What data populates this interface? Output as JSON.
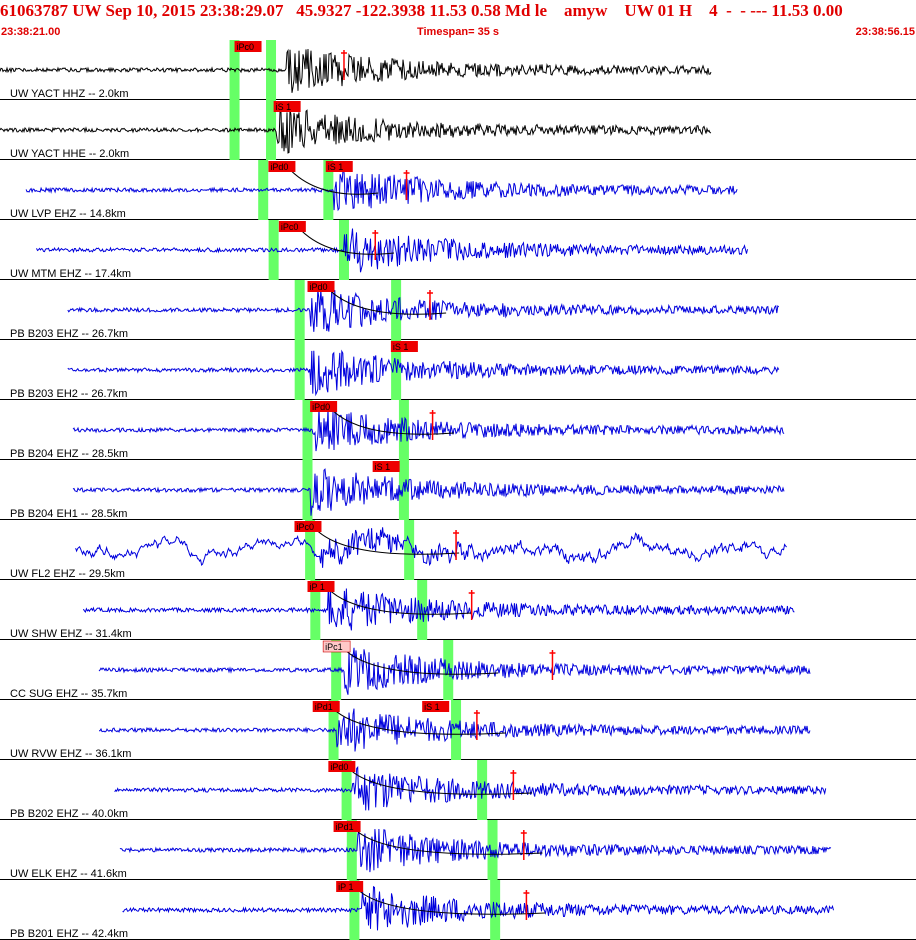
{
  "header": {
    "title": "61063787 UW Sep 10, 2015 23:38:29.07   45.9327 -122.3938 11.53 0.58 Md le    amyw    UW 01 H    4  -  - --- 11.53 0.00",
    "start_time": "23:38:21.00",
    "timespan": "Timespan= 35 s",
    "end_time": "23:38:56.15"
  },
  "colors": {
    "header_text": "#e00000",
    "trace_unfiltered": "#000000",
    "trace": "#0000dd",
    "pick_box": "#ee0000",
    "pick_box_weak": "#ffc8c8",
    "pick_window": "#66ff66",
    "pick_mark": "#ff0000"
  },
  "chart_data": {
    "type": "line",
    "title": "",
    "x_unit": "s",
    "xlim": [
      0,
      35.15
    ],
    "traces": [
      {
        "label": "UW YACT HHZ -- 2.0km",
        "color": "black",
        "start": 0,
        "end": 27.3,
        "amp": 1,
        "p_pick": {
          "label": "iPc0",
          "time": 9.0,
          "weak": false
        },
        "s_pick": null,
        "green": [
          9.0,
          10.4
        ],
        "arrival": 11.0,
        "red_marks": [
          13.2
        ],
        "pcurve": false,
        "wander": false
      },
      {
        "label": "UW YACT HHE -- 2.0km",
        "color": "black",
        "start": 0,
        "end": 27.3,
        "amp": 1,
        "p_pick": null,
        "s_pick": {
          "label": "iS 1",
          "time": 10.5,
          "weak": false
        },
        "green": [
          9.0,
          10.4
        ],
        "arrival": 10.6,
        "red_marks": [],
        "pcurve": false,
        "wander": false
      },
      {
        "label": "UW LVP EHZ -- 14.8km",
        "color": "blue",
        "start": 1.0,
        "end": 28.3,
        "amp": 1,
        "p_pick": {
          "label": "iPd0",
          "time": 10.3,
          "weak": false
        },
        "s_pick": {
          "label": "iS 1",
          "time": 12.5,
          "weak": false
        },
        "green": [
          10.1,
          12.6
        ],
        "arrival": 12.8,
        "red_marks": [
          15.6
        ],
        "pcurve": true,
        "wander": false
      },
      {
        "label": "UW MTM EHZ -- 17.4km",
        "color": "blue",
        "start": 1.4,
        "end": 28.7,
        "amp": 1,
        "p_pick": {
          "label": "iPc0",
          "time": 10.7,
          "weak": false
        },
        "s_pick": null,
        "green": [
          10.5,
          13.2
        ],
        "arrival": 13.2,
        "red_marks": [
          14.4
        ],
        "pcurve": true,
        "wander": false
      },
      {
        "label": "PB B203 EHZ -- 26.7km",
        "color": "blue",
        "start": 2.6,
        "end": 29.9,
        "amp": 1,
        "p_pick": {
          "label": "iPd0",
          "time": 11.8,
          "weak": false
        },
        "s_pick": null,
        "green": [
          11.5,
          15.2
        ],
        "arrival": 11.9,
        "red_marks": [
          16.5
        ],
        "pcurve": true,
        "wander": false
      },
      {
        "label": "PB B203 EH2 -- 26.7km",
        "color": "blue",
        "start": 2.6,
        "end": 29.9,
        "amp": 1,
        "p_pick": null,
        "s_pick": {
          "label": "iS 1",
          "time": 15.0,
          "weak": false
        },
        "green": [
          11.5,
          15.2
        ],
        "arrival": 11.9,
        "red_marks": [],
        "pcurve": false,
        "wander": false
      },
      {
        "label": "PB B204 EHZ -- 28.5km",
        "color": "blue",
        "start": 2.8,
        "end": 30.1,
        "amp": 1,
        "p_pick": {
          "label": "iPd0",
          "time": 11.9,
          "weak": false
        },
        "s_pick": null,
        "green": [
          11.8,
          15.5
        ],
        "arrival": 11.9,
        "red_marks": [
          16.6
        ],
        "pcurve": true,
        "wander": false
      },
      {
        "label": "PB B204 EH1 -- 28.5km",
        "color": "blue",
        "start": 2.8,
        "end": 30.1,
        "amp": 1,
        "p_pick": null,
        "s_pick": {
          "label": "iS 1",
          "time": 14.3,
          "weak": false
        },
        "green": [
          11.8,
          15.5
        ],
        "arrival": 11.9,
        "red_marks": [],
        "pcurve": false,
        "wander": false
      },
      {
        "label": "UW FL2 EHZ -- 29.5km",
        "color": "blue",
        "start": 2.9,
        "end": 30.2,
        "amp": 1,
        "p_pick": {
          "label": "iPc0",
          "time": 11.3,
          "weak": false
        },
        "s_pick": null,
        "green": [
          11.9,
          15.7
        ],
        "arrival": 12.3,
        "red_marks": [
          17.5
        ],
        "pcurve": true,
        "wander": true
      },
      {
        "label": "UW SHW EHZ -- 31.4km",
        "color": "blue",
        "start": 3.2,
        "end": 30.5,
        "amp": 1,
        "p_pick": {
          "label": "iP 1",
          "time": 11.8,
          "weak": false
        },
        "s_pick": null,
        "green": [
          12.1,
          16.2
        ],
        "arrival": 12.6,
        "red_marks": [
          18.1
        ],
        "pcurve": true,
        "wander": false
      },
      {
        "label": "CC SUG EHZ -- 35.7km",
        "color": "blue",
        "start": 3.8,
        "end": 31.1,
        "amp": 1,
        "p_pick": {
          "label": "iPc1",
          "time": 12.4,
          "weak": true
        },
        "s_pick": null,
        "green": [
          12.9,
          17.2
        ],
        "arrival": 13.2,
        "red_marks": [
          21.2
        ],
        "pcurve": true,
        "wander": false
      },
      {
        "label": "UW RVW EHZ -- 36.1km",
        "color": "blue",
        "start": 3.8,
        "end": 31.1,
        "amp": 1,
        "p_pick": {
          "label": "iPd1",
          "time": 12.0,
          "weak": false
        },
        "s_pick": {
          "label": "iS 1",
          "time": 16.2,
          "weak": false
        },
        "green": [
          12.8,
          17.5
        ],
        "arrival": 12.9,
        "red_marks": [
          18.3
        ],
        "pcurve": true,
        "wander": false
      },
      {
        "label": "PB B202 EHZ -- 40.0km",
        "color": "blue",
        "start": 4.4,
        "end": 31.7,
        "amp": 1,
        "p_pick": {
          "label": "iPd0",
          "time": 12.6,
          "weak": false
        },
        "s_pick": null,
        "green": [
          13.3,
          18.5
        ],
        "arrival": 13.5,
        "red_marks": [
          19.7
        ],
        "pcurve": true,
        "wander": false
      },
      {
        "label": "UW ELK EHZ -- 41.6km",
        "color": "blue",
        "start": 4.6,
        "end": 31.9,
        "amp": 1,
        "p_pick": {
          "label": "iPd1",
          "time": 12.8,
          "weak": false
        },
        "s_pick": null,
        "green": [
          13.5,
          18.9
        ],
        "arrival": 13.7,
        "red_marks": [
          20.1
        ],
        "pcurve": true,
        "wander": false
      },
      {
        "label": "PB B201 EHZ -- 42.4km",
        "color": "blue",
        "start": 4.7,
        "end": 32.0,
        "amp": 1,
        "p_pick": {
          "label": "iP 1",
          "time": 12.9,
          "weak": false
        },
        "s_pick": null,
        "green": [
          13.6,
          19.0
        ],
        "arrival": 13.9,
        "red_marks": [
          20.2
        ],
        "pcurve": true,
        "wander": false
      }
    ]
  }
}
